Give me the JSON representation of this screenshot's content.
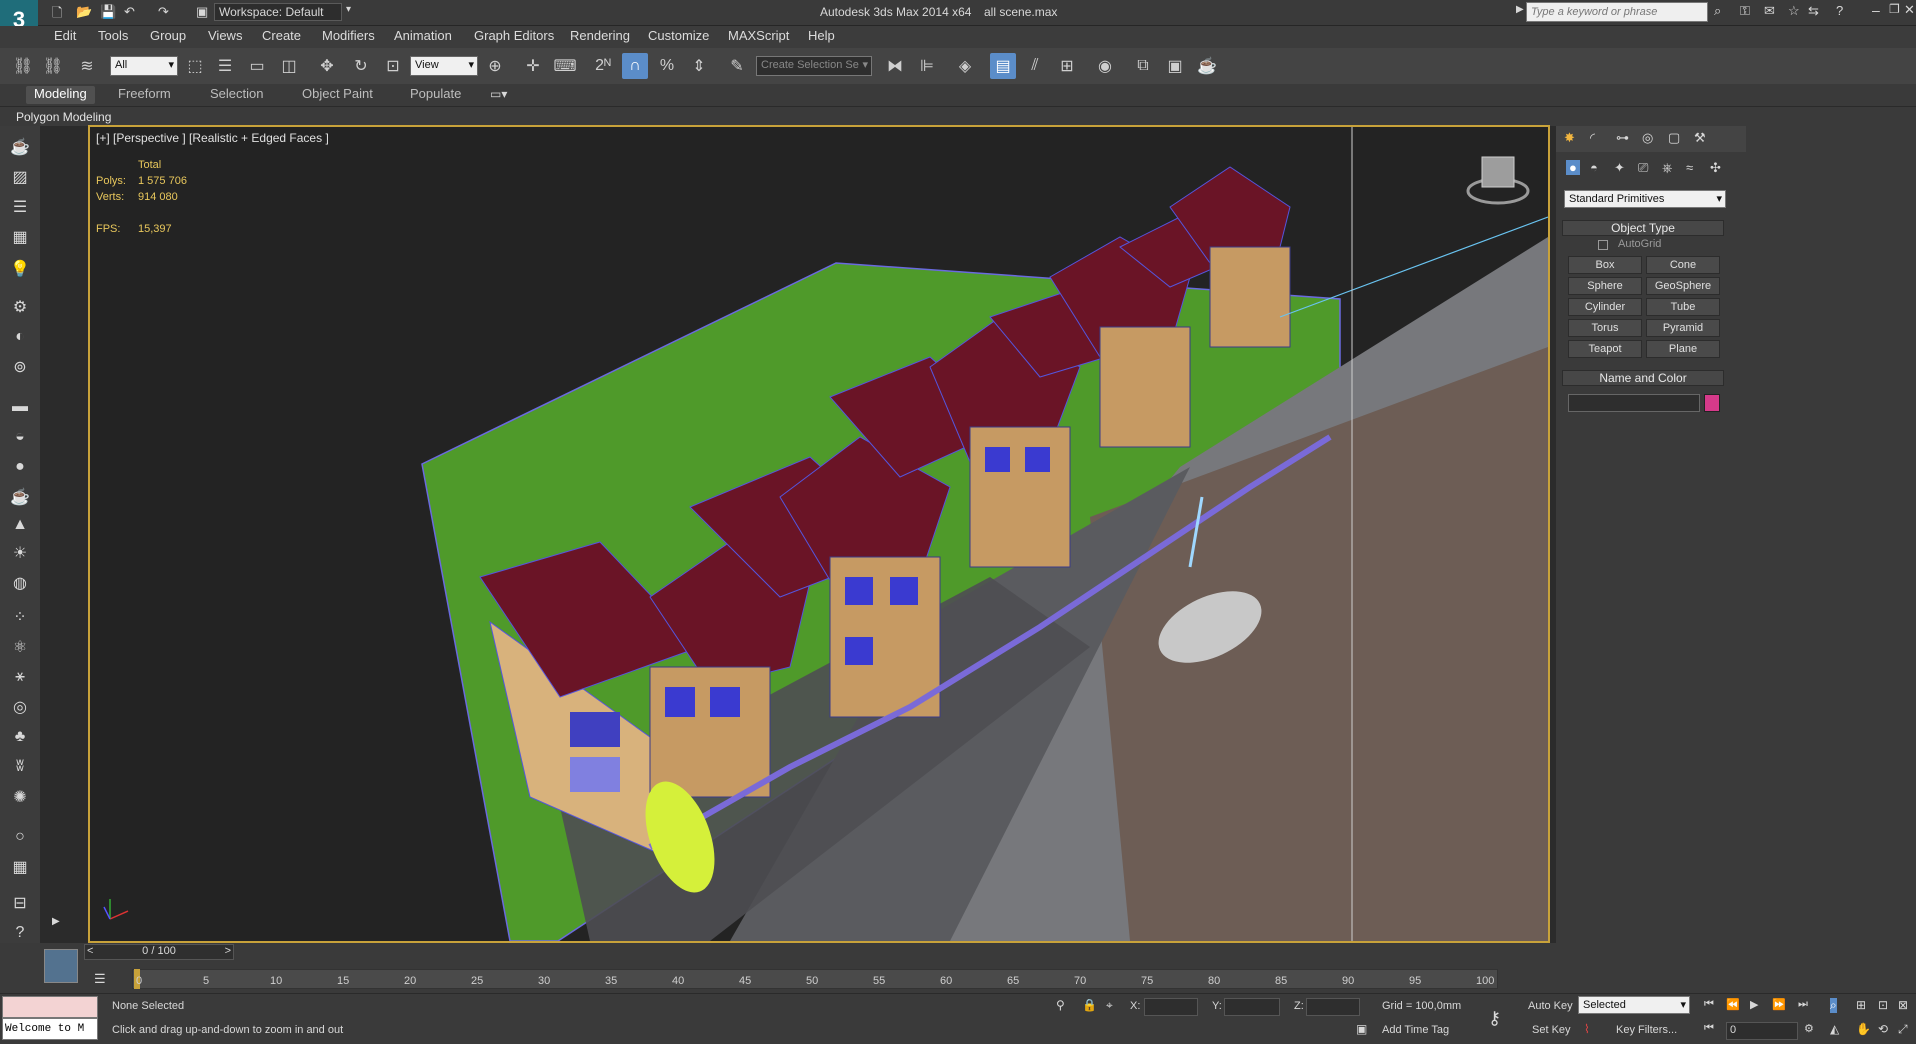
{
  "titlebar": {
    "workspace_label": "Workspace: Default",
    "app_title": "Autodesk 3ds Max  2014 x64",
    "file_name": "all scene.max",
    "search_placeholder": "Type a keyword or phrase"
  },
  "menu": [
    "Edit",
    "Tools",
    "Group",
    "Views",
    "Create",
    "Modifiers",
    "Animation",
    "Graph Editors",
    "Rendering",
    "Customize",
    "MAXScript",
    "Help"
  ],
  "toolbar": {
    "filter_select": "All",
    "refcoord_select": "View",
    "selection_set_placeholder": "Create Selection Se"
  },
  "ribbon": {
    "tabs": [
      "Modeling",
      "Freeform",
      "Selection",
      "Object Paint",
      "Populate"
    ],
    "panel_label": "Polygon Modeling"
  },
  "viewport": {
    "label": "[+] [Perspective ] [Realistic + Edged Faces ]",
    "stats_total": "Total",
    "stats_polys_label": "Polys:",
    "stats_polys_value": "1 575 706",
    "stats_verts_label": "Verts:",
    "stats_verts_value": "914 080",
    "fps_label": "FPS:",
    "fps_value": "15,397"
  },
  "command_panel": {
    "category_select": "Standard Primitives",
    "object_type_title": "Object Type",
    "autogrid_label": "AutoGrid",
    "primitives": [
      "Box",
      "Cone",
      "Sphere",
      "GeoSphere",
      "Cylinder",
      "Tube",
      "Torus",
      "Pyramid",
      "Teapot",
      "Plane"
    ],
    "name_color_title": "Name and Color",
    "color_swatch": "#d63a8a"
  },
  "timeline": {
    "frame_counter": "0 / 100",
    "ticks": [
      "0",
      "5",
      "10",
      "15",
      "20",
      "25",
      "30",
      "35",
      "40",
      "45",
      "50",
      "55",
      "60",
      "65",
      "70",
      "75",
      "80",
      "85",
      "90",
      "95",
      "100"
    ]
  },
  "status": {
    "maxscript_listener": "Welcome to M",
    "selection_status": "None Selected",
    "prompt": "Click and drag up-and-down to zoom in and out",
    "x_label": "X:",
    "y_label": "Y:",
    "z_label": "Z:",
    "grid": "Grid = 100,0mm",
    "add_time_tag": "Add Time Tag",
    "auto_key": "Auto Key",
    "set_key": "Set Key",
    "key_mode_select": "Selected",
    "key_filters": "Key Filters...",
    "current_frame": "0"
  },
  "colors": {
    "accent_blue": "#5b8dc9",
    "viewport_border": "#c8a23a",
    "roof": "#6a1426",
    "grass": "#4f9a2a"
  }
}
